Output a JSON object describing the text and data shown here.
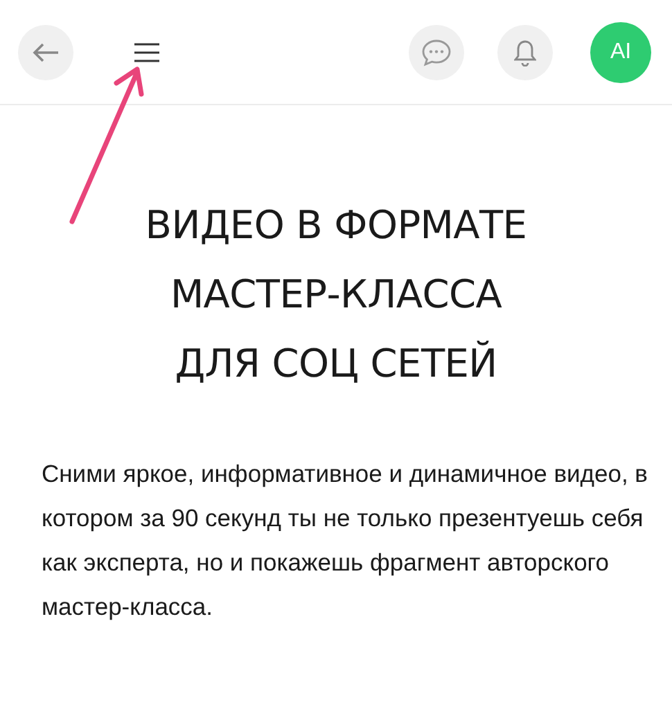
{
  "header": {
    "avatar": "AI"
  },
  "title_lines": [
    "ВИДЕО В ФОРМАТЕ",
    "МАСТЕР-КЛАССА",
    "ДЛЯ СОЦ СЕТЕЙ"
  ],
  "description": "Сними яркое, информативное и динамичное видео, в котором за 90 секунд ты не только презентуешь себя как эксперта, но и покажешь фрагмент авторского мастер-класса."
}
